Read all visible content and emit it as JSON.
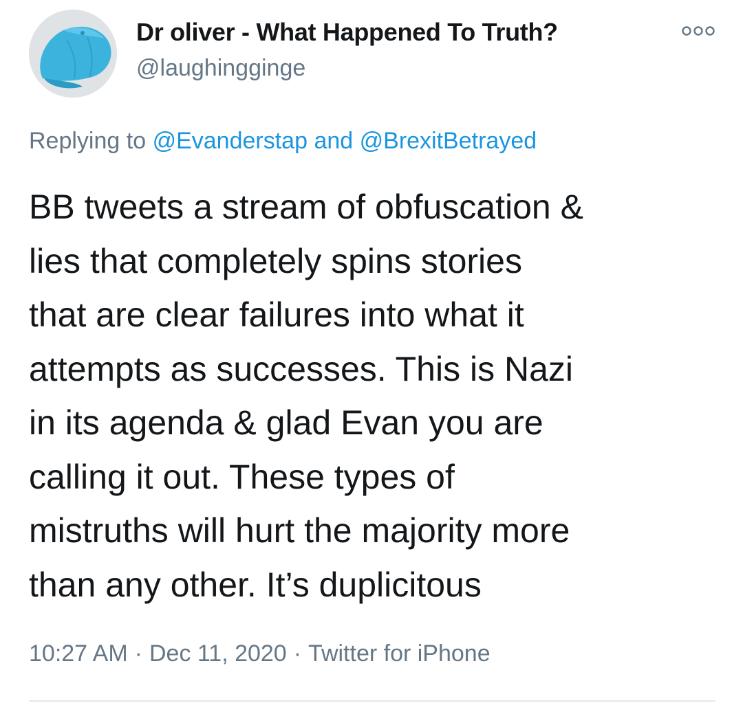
{
  "author": {
    "display_name": "Dr oliver - What Happened To Truth?",
    "handle": "@laughingginge",
    "avatar_icon": "blue-cap-avatar"
  },
  "more_icon": "more-options-icon",
  "reply": {
    "prefix": "Replying to",
    "user1": "@Evanderstap",
    "conjunction": "and",
    "user2": "@BrexitBetrayed"
  },
  "tweet": {
    "lines": [
      "BB tweets a stream of obfuscation &",
      "lies that completely spins stories",
      "that are clear failures into what it",
      "attempts as successes. This is Nazi",
      "in its agenda & glad Evan you are",
      "calling it out. These types of",
      "mistruths will hurt the majority more",
      "than any other. It’s duplicitous"
    ]
  },
  "meta": {
    "time": "10:27 AM",
    "date": "Dec 11, 2020",
    "source": "Twitter for iPhone",
    "separator": "·"
  },
  "colors": {
    "text": "#14171a",
    "secondary": "#657786",
    "link": "#1b95e0",
    "divider": "#e1e8ed"
  }
}
